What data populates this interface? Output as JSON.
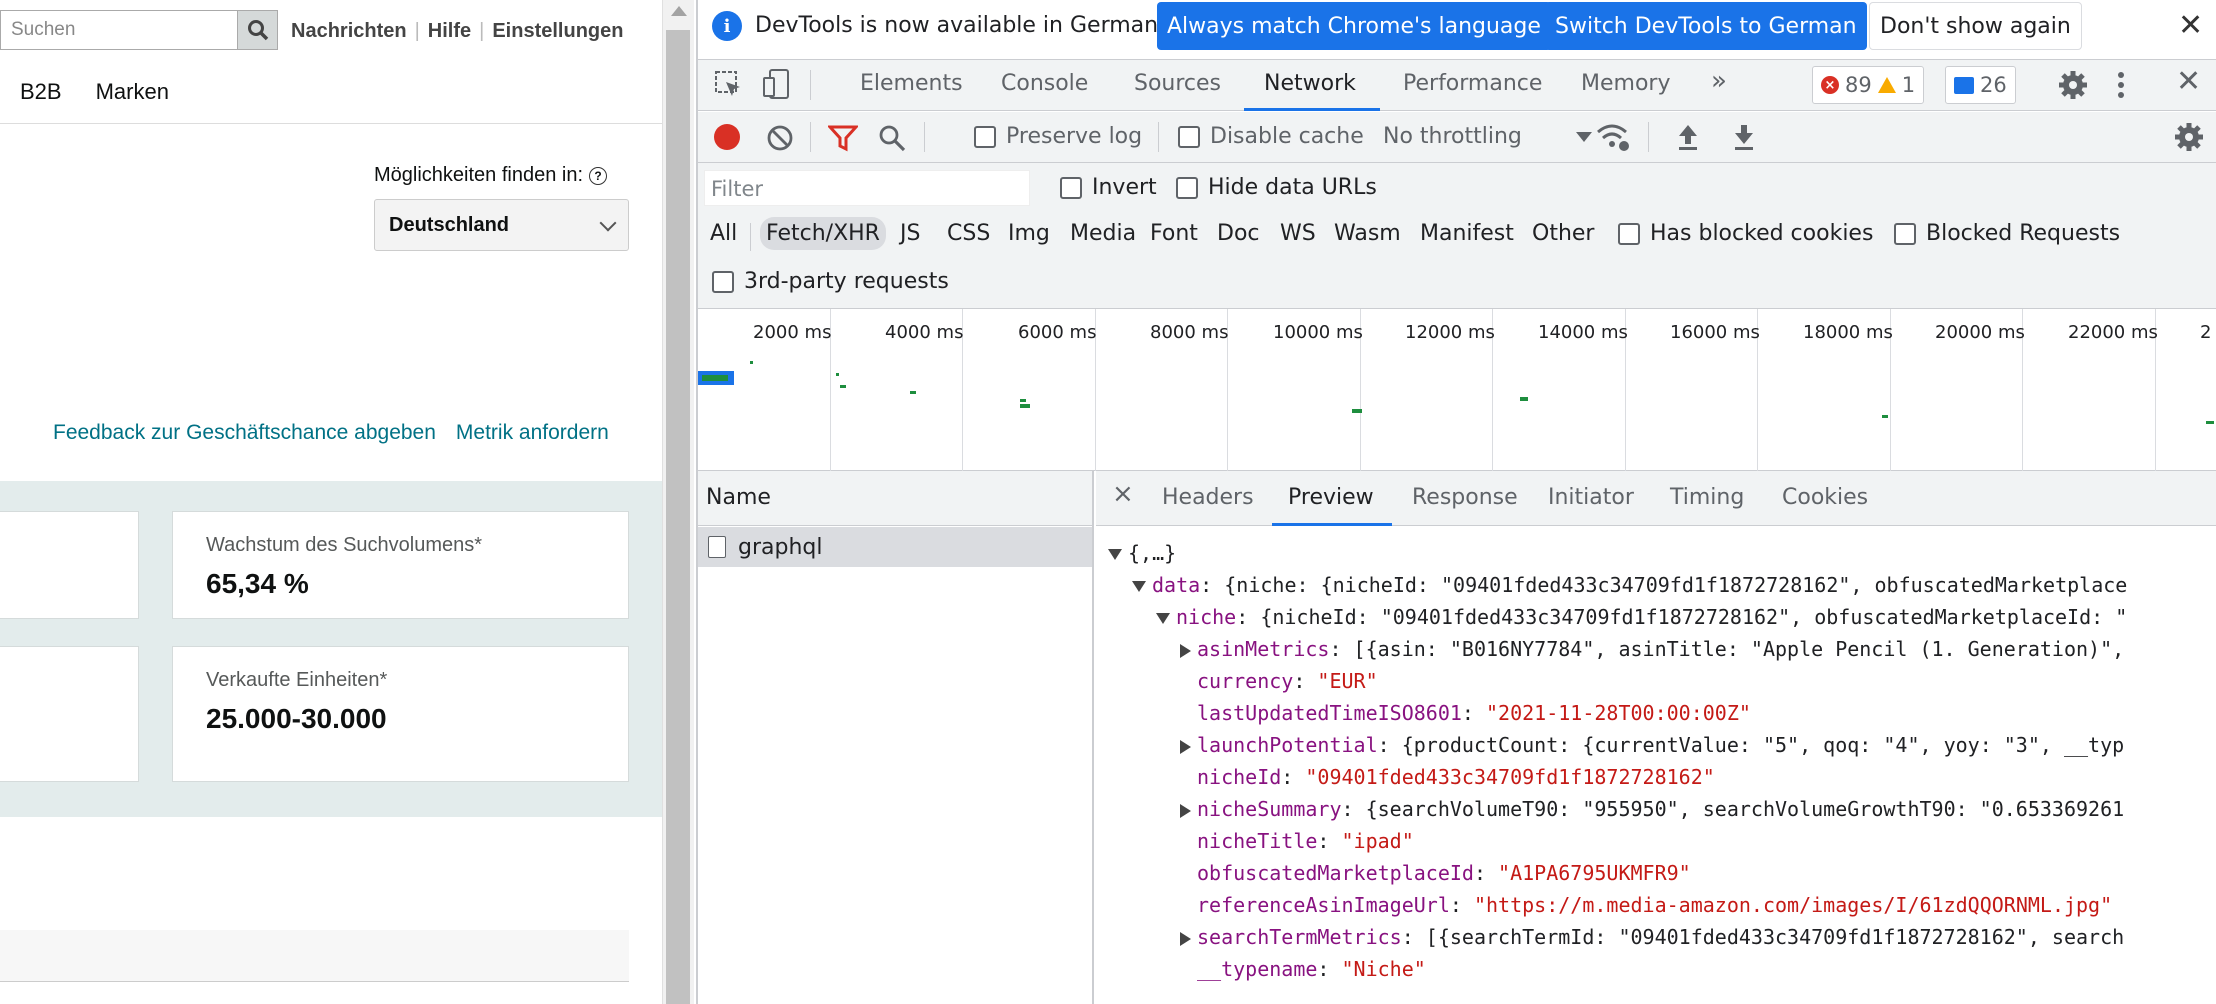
{
  "page": {
    "search_placeholder": "Suchen",
    "top_links": [
      "Nachrichten",
      "Hilfe",
      "Einstellungen"
    ],
    "nav": [
      "B2B",
      "Marken"
    ],
    "finden_label": "Möglichkeiten finden in:",
    "country_select": "Deutschland",
    "link_feedback": "Feedback zur Geschäftschance abgeben",
    "link_metrik": "Metrik anfordern",
    "card1_label": "Wachstum des Suchvolumens*",
    "card1_value": "65,34 %",
    "card2_label": "Verkaufte Einheiten*",
    "card2_value": "25.000-30.000"
  },
  "devtools": {
    "banner_text": "DevTools is now available in German!",
    "btn_match": "Always match Chrome's language",
    "btn_switch": "Switch DevTools to German",
    "btn_dont": "Don't show again",
    "tabs": [
      "Elements",
      "Console",
      "Sources",
      "Network",
      "Performance",
      "Memory"
    ],
    "more_tabs": "»",
    "errors": "89",
    "warnings": "1",
    "messages": "26",
    "preserve_log": "Preserve log",
    "disable_cache": "Disable cache",
    "throttling": "No throttling",
    "filter_placeholder": "Filter",
    "invert": "Invert",
    "hide_data_urls": "Hide data URLs",
    "filter_types": [
      "All",
      "Fetch/XHR",
      "JS",
      "CSS",
      "Img",
      "Media",
      "Font",
      "Doc",
      "WS",
      "Wasm",
      "Manifest",
      "Other"
    ],
    "has_blocked_cookies": "Has blocked cookies",
    "blocked_requests": "Blocked Requests",
    "third_party": "3rd-party requests",
    "timeline_ticks": [
      "2000 ms",
      "4000 ms",
      "6000 ms",
      "8000 ms",
      "10000 ms",
      "12000 ms",
      "14000 ms",
      "16000 ms",
      "18000 ms",
      "20000 ms",
      "22000 ms",
      "2"
    ],
    "name_header": "Name",
    "request_name": "graphql",
    "detail_close": "×",
    "detail_tabs": [
      "Headers",
      "Preview",
      "Response",
      "Initiator",
      "Timing",
      "Cookies"
    ],
    "preview": {
      "root": "{,…}",
      "data_key": "data",
      "data_val": "{niche: {nicheId: \"09401fded433c34709fd1f1872728162\", obfuscatedMarketplace",
      "niche_key": "niche",
      "niche_val": "{nicheId: \"09401fded433c34709fd1f1872728162\", obfuscatedMarketplaceId: \"",
      "asinMetrics_key": "asinMetrics",
      "asinMetrics_val": "[{asin: \"B016NY7784\", asinTitle: \"Apple Pencil (1. Generation)\",",
      "currency_key": "currency",
      "currency_val": "\"EUR\"",
      "lastUpdated_key": "lastUpdatedTimeISO8601",
      "lastUpdated_val": "\"2021-11-28T00:00:00Z\"",
      "launch_key": "launchPotential",
      "launch_val": "{productCount: {currentValue: \"5\", qoq: \"4\", yoy: \"3\", __typ",
      "nicheId_key": "nicheId",
      "nicheId_val": "\"09401fded433c34709fd1f1872728162\"",
      "summary_key": "nicheSummary",
      "summary_val": "{searchVolumeT90: \"955950\", searchVolumeGrowthT90: \"0.653369261",
      "title_key": "nicheTitle",
      "title_val": "\"ipad\"",
      "market_key": "obfuscatedMarketplaceId",
      "market_val": "\"A1PA6795UKMFR9\"",
      "ref_key": "referenceAsinImageUrl",
      "ref_val": "\"https://m.media-amazon.com/images/I/61zdQQORNML.jpg\"",
      "stm_key": "searchTermMetrics",
      "stm_val": "[{searchTermId: \"09401fded433c34709fd1f1872728162\", search",
      "typename_key": "__typename",
      "typename_val": "\"Niche\""
    }
  },
  "colors": {
    "accent": "#1a73e8",
    "link": "#007185",
    "record": "#d93025"
  }
}
